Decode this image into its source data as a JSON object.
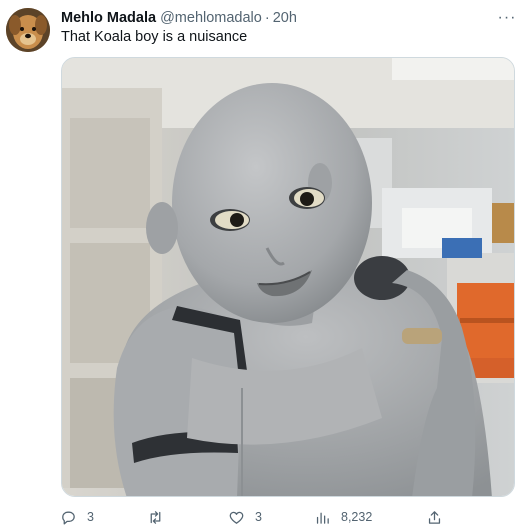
{
  "tweet": {
    "display_name": "Mehlo Madala",
    "handle": "@mehlomadalo",
    "separator": "·",
    "time": "20h",
    "text": "That Koala boy is a nuisance",
    "more_label": "···"
  },
  "actions": {
    "reply": {
      "icon": "reply-icon",
      "count": "3"
    },
    "retweet": {
      "icon": "retweet-icon",
      "count": ""
    },
    "like": {
      "icon": "heart-icon",
      "count": "3"
    },
    "views": {
      "icon": "views-icon",
      "count": "8,232"
    },
    "share": {
      "icon": "share-icon",
      "count": ""
    }
  },
  "colors": {
    "text": "#0f1419",
    "muted": "#536471",
    "border": "#cfd9de"
  }
}
